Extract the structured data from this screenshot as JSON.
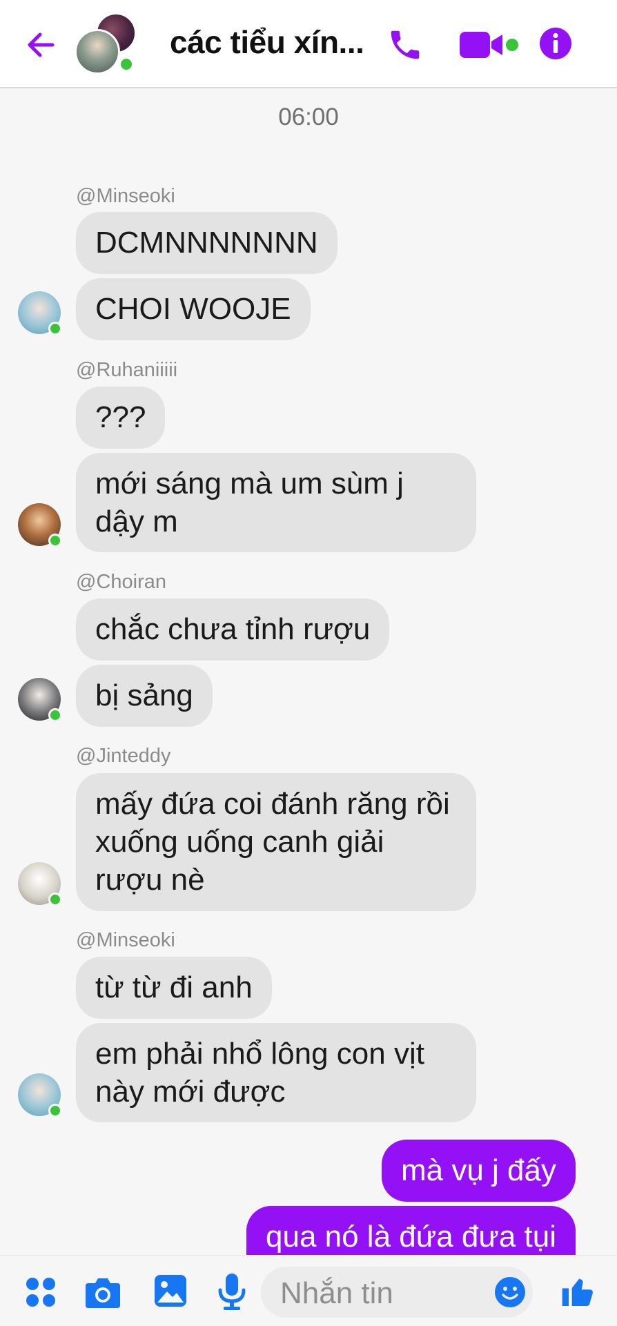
{
  "header": {
    "title": "các tiểu xín...",
    "colors": {
      "accent": "#9410f5",
      "online": "#3ac43a"
    }
  },
  "chat": {
    "time": "06:00",
    "messages": [
      {
        "sender": "@Minseoki",
        "bubbles": [
          "DCMNNNNNNN",
          "CHOI WOOJE"
        ]
      },
      {
        "sender": "@Ruhaniiiii",
        "bubbles": [
          "???",
          "mới sáng mà um sùm j dậy m"
        ]
      },
      {
        "sender": "@Choiran",
        "bubbles": [
          "chắc chưa tỉnh rượu",
          "bị sảng"
        ]
      },
      {
        "sender": "@Jinteddy",
        "bubbles": [
          "mấy đứa coi đánh răng rồi xuống uống canh giải rượu nè"
        ]
      },
      {
        "sender": "@Minseoki",
        "bubbles": [
          "từ từ đi anh",
          "em phải nhổ lông con vịt này mới được"
        ]
      }
    ],
    "outgoing": [
      "mà vụ j đấy",
      "qua nó là đứa đưa tụi"
    ]
  },
  "composer": {
    "placeholder": "Nhắn tin",
    "icons": [
      "apps-icon",
      "camera-icon",
      "gallery-icon",
      "microphone-icon",
      "emoji-icon",
      "like-icon"
    ]
  }
}
